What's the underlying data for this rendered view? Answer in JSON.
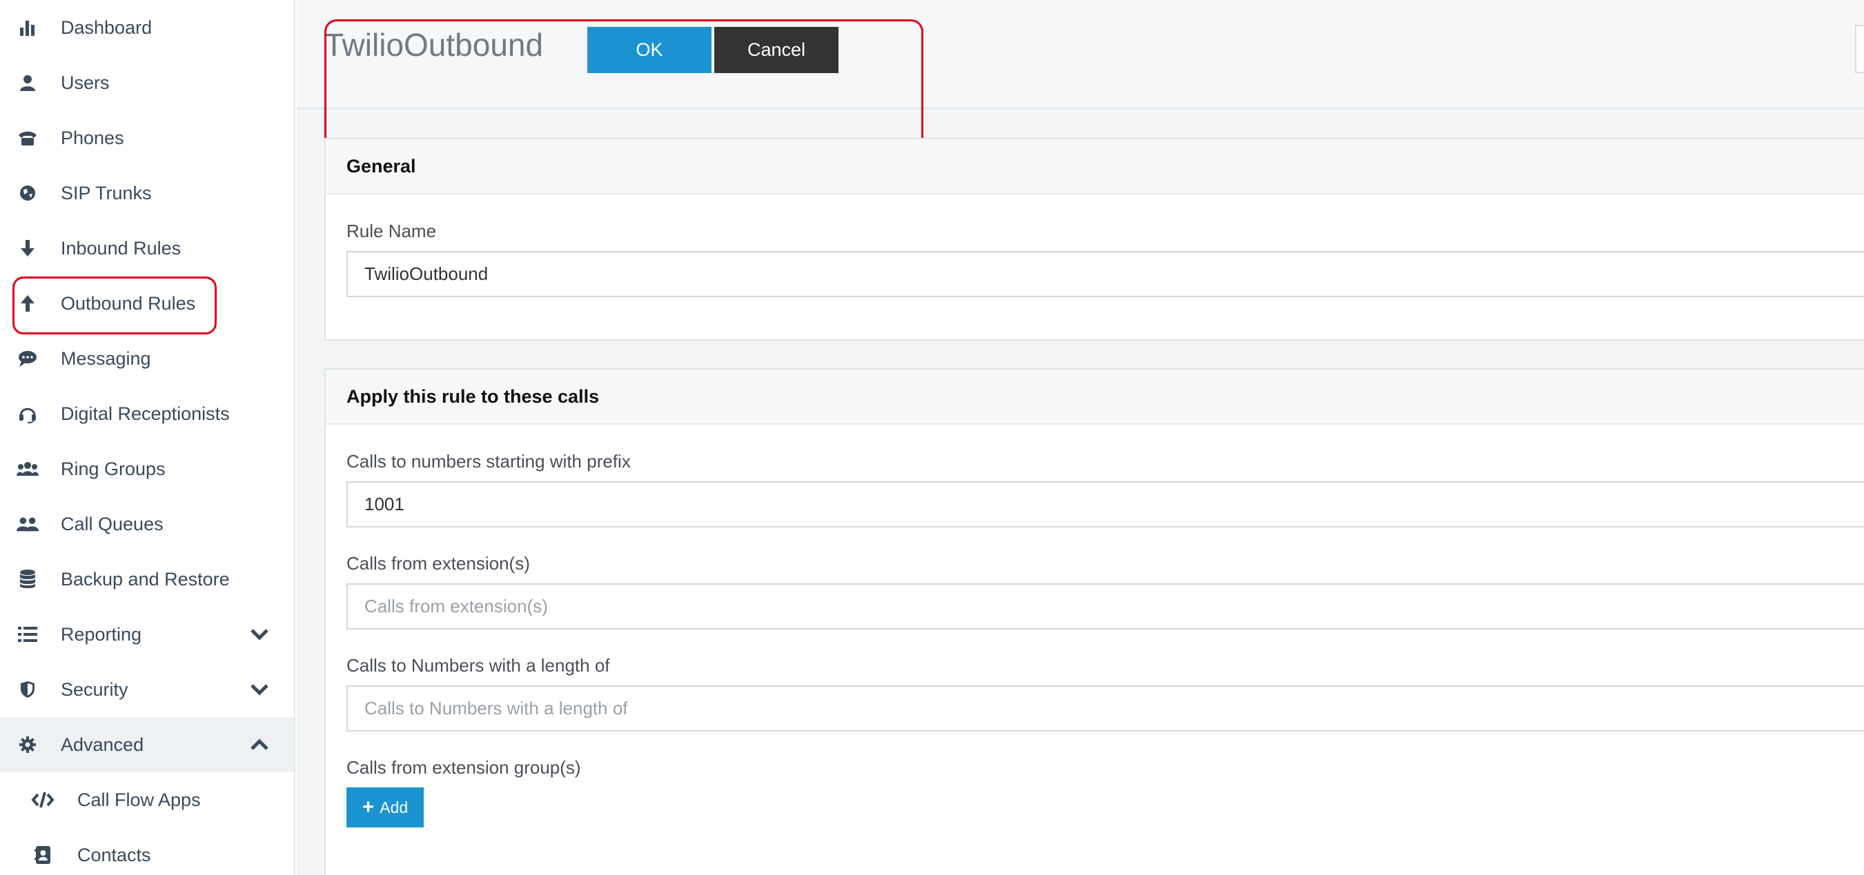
{
  "sidebar": {
    "items": [
      {
        "label": "Dashboard",
        "icon": "bar-chart-icon"
      },
      {
        "label": "Users",
        "icon": "user-icon"
      },
      {
        "label": "Phones",
        "icon": "phone-icon"
      },
      {
        "label": "SIP Trunks",
        "icon": "globe-icon"
      },
      {
        "label": "Inbound Rules",
        "icon": "arrow-down-icon"
      },
      {
        "label": "Outbound Rules",
        "icon": "arrow-up-icon"
      },
      {
        "label": "Messaging",
        "icon": "chat-icon"
      },
      {
        "label": "Digital Receptionists",
        "icon": "headset-icon"
      },
      {
        "label": "Ring Groups",
        "icon": "group-icon"
      },
      {
        "label": "Call Queues",
        "icon": "users-queue-icon"
      },
      {
        "label": "Backup and Restore",
        "icon": "database-icon"
      },
      {
        "label": "Reporting",
        "icon": "list-icon",
        "chevron": "down"
      },
      {
        "label": "Security",
        "icon": "shield-icon",
        "chevron": "down"
      },
      {
        "label": "Advanced",
        "icon": "gear-icon",
        "chevron": "up"
      },
      {
        "label": "Call Flow Apps",
        "icon": "code-icon"
      },
      {
        "label": "Contacts",
        "icon": "address-book-icon"
      }
    ],
    "highlighted": "Outbound Rules"
  },
  "header": {
    "title": "TwilioOutbound",
    "ok_label": "OK",
    "cancel_label": "Cancel"
  },
  "general": {
    "heading": "General",
    "rule_name_label": "Rule Name",
    "rule_name_value": "TwilioOutbound"
  },
  "apply": {
    "heading": "Apply this rule to these calls",
    "prefix_label": "Calls to numbers starting with prefix",
    "prefix_value": "1001",
    "from_ext_label": "Calls from extension(s)",
    "from_ext_placeholder": "Calls from extension(s)",
    "length_label": "Calls to Numbers with a length of",
    "length_placeholder": "Calls to Numbers with a length of",
    "group_label": "Calls from extension group(s)",
    "add_label": "Add"
  },
  "colors": {
    "accent": "#1b93d1",
    "dark_button": "#333333",
    "highlight": "#e0001b",
    "sidebar_text": "#3a4a5a"
  }
}
